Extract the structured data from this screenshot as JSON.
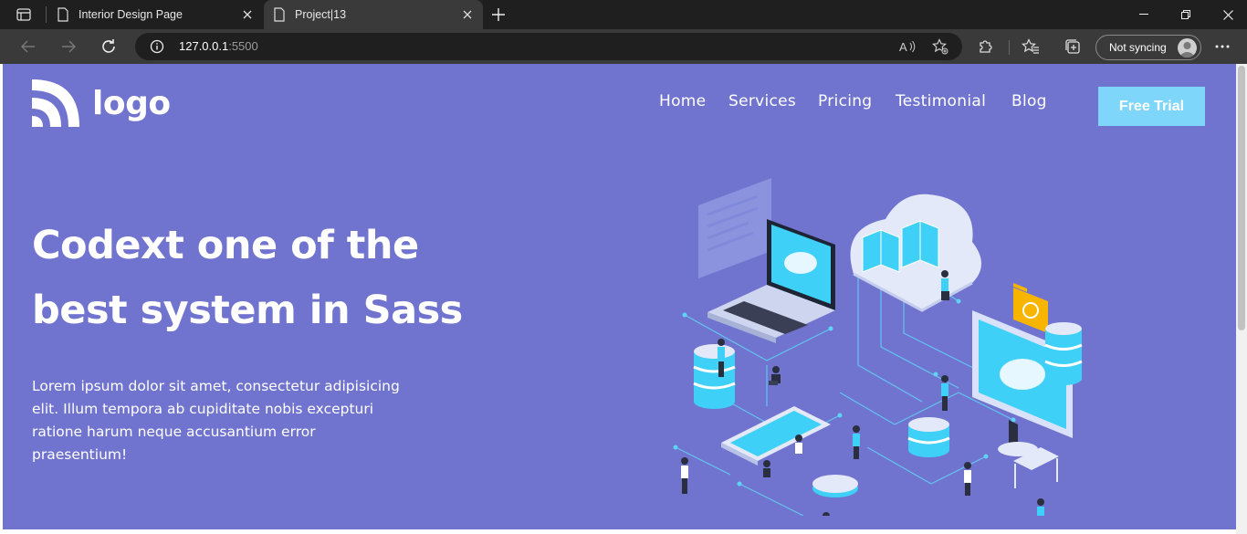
{
  "browser": {
    "tabs": [
      {
        "title": "Interior Design Page",
        "active": false
      },
      {
        "title": "Project|13",
        "active": true
      }
    ],
    "url_host": "127.0.0.1",
    "url_port": ":5500",
    "profile_label": "Not syncing"
  },
  "site": {
    "logo_text": "logo",
    "nav": [
      "Home",
      "Services",
      "Pricing",
      "Testimonial",
      "Blog"
    ],
    "cta_label": "Free Trial",
    "hero": {
      "title_line1": "Codext one of the",
      "title_line2": "best system in Sass",
      "body_line1": "Lorem ipsum dolor sit amet, consectetur adipisicing",
      "body_line2": "elit. Illum tempora ab cupiditate nobis excepturi",
      "body_line3": "ratione harum neque accusantium error",
      "body_line4": "praesentium!"
    }
  },
  "colors": {
    "hero_background": "#7074cf",
    "cta_background": "#7fd6fb",
    "illustration_accent": "#2ec6f3"
  }
}
